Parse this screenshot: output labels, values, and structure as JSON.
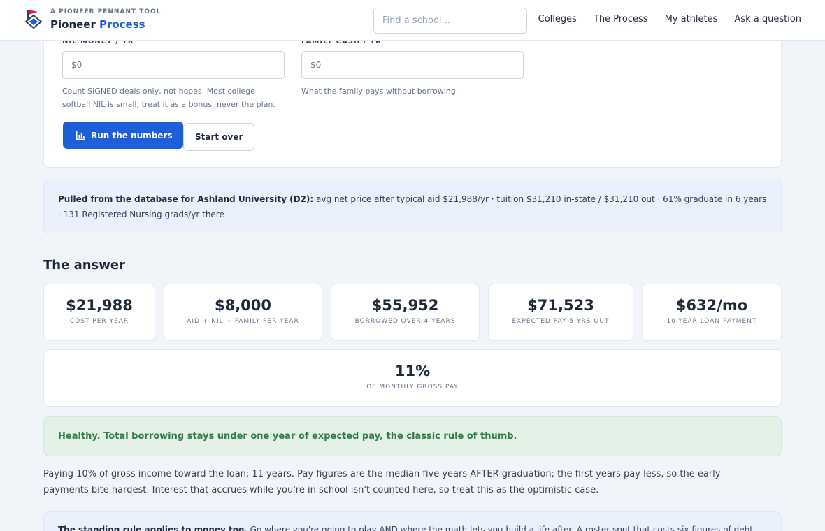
{
  "brand": {
    "eyebrow": "A PIONEER PENNANT TOOL",
    "name": "Pioneer",
    "accent": "Process"
  },
  "search": {
    "placeholder": "Find a school..."
  },
  "nav": [
    "Colleges",
    "The Process",
    "My athletes",
    "Ask a question"
  ],
  "form": {
    "nil": {
      "label": "NIL MONEY / YR",
      "placeholder": "$0",
      "help": "Count SIGNED deals only, not hopes. Most college softball NIL is small; treat it as a bonus, never the plan."
    },
    "family": {
      "label": "FAMILY CASH / YR",
      "placeholder": "$0",
      "help": "What the family pays without borrowing."
    },
    "run_label": "Run the numbers",
    "reset_label": "Start over"
  },
  "db_note": {
    "lead": "Pulled from the database for Ashland University (D2):",
    "detail": "avg net price after typical aid $21,988/yr · tuition $31,210 in-state / $31,210 out · 61% graduate in 6 years · 131 Registered Nursing grads/yr there"
  },
  "answer": {
    "title": "The answer",
    "stats": [
      {
        "value": "$21,988",
        "label": "COST PER YEAR"
      },
      {
        "value": "$8,000",
        "label": "AID + NIL + FAMILY PER YEAR"
      },
      {
        "value": "$55,952",
        "label": "BORROWED OVER 4 YEARS"
      },
      {
        "value": "$71,523",
        "label": "EXPECTED PAY 5 YRS OUT"
      },
      {
        "value": "$632/mo",
        "label": "10-YEAR LOAN PAYMENT"
      }
    ],
    "share": {
      "value": "11%",
      "label": "OF MONTHLY GROSS PAY"
    },
    "verdict": "Healthy. Total borrowing stays under one year of expected pay, the classic rule of thumb.",
    "explanation": "Paying 10% of gross income toward the loan: 11 years. Pay figures are the median five years AFTER graduation; the first years pay less, so the early payments bite hardest. Interest that accrues while you're in school isn't counted here, so treat this as the optimistic case.",
    "rule_lead": "The standing rule applies to money too.",
    "rule_text": "Go where you're going to play AND where the math lets you build a life after. A roster spot that costs six figures of debt"
  },
  "colors": {
    "accent": "#1d5fd9",
    "healthy_bg": "#e3f1e6",
    "healthy_text": "#2e7d46",
    "info_bg": "#eaf1fd"
  },
  "icons": {
    "logo": "pennant-logo-icon",
    "chart": "bar-chart-icon"
  }
}
